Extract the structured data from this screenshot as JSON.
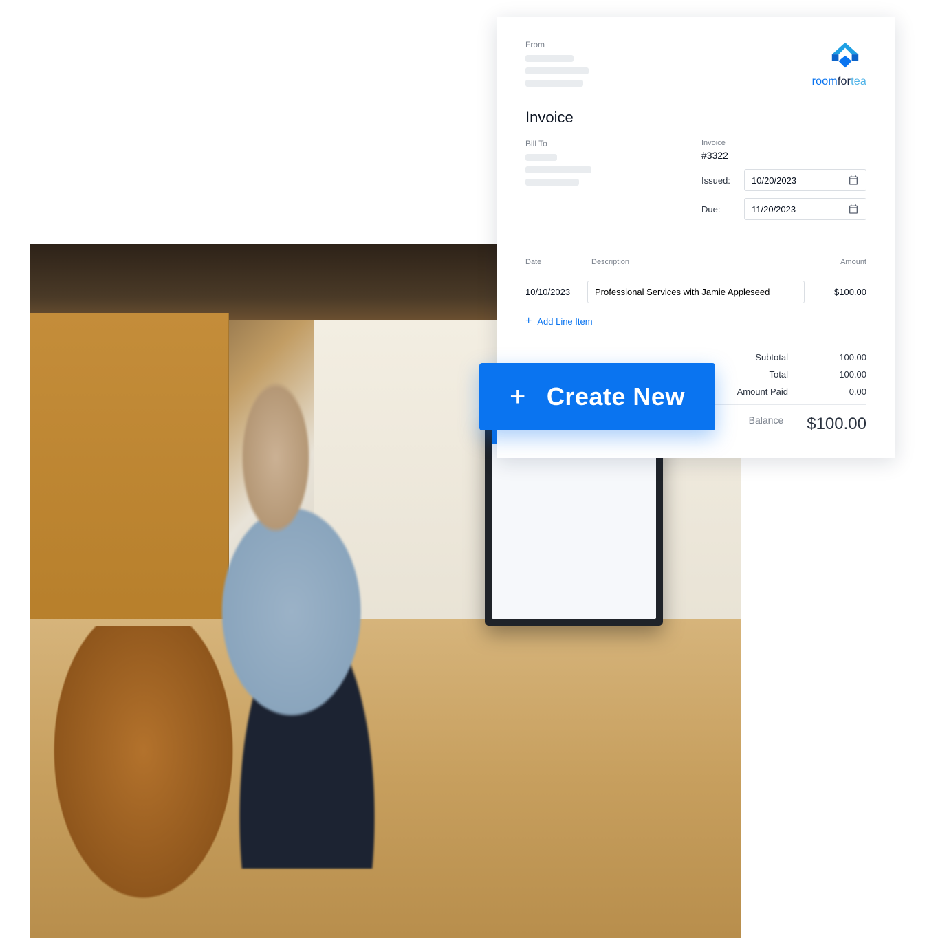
{
  "brand": {
    "word1": "room",
    "word2": "for",
    "word3": "tea"
  },
  "invoice": {
    "from_label": "From",
    "title": "Invoice",
    "billto_label": "Bill To",
    "meta": {
      "label": "Invoice",
      "number": "#3322",
      "issued_label": "Issued:",
      "issued_date": "10/20/2023",
      "due_label": "Due:",
      "due_date": "11/20/2023"
    },
    "columns": {
      "date": "Date",
      "description": "Description",
      "amount": "Amount"
    },
    "lines": [
      {
        "date": "10/10/2023",
        "description": "Professional Services with Jamie Appleseed",
        "amount": "$100.00"
      }
    ],
    "add_line_label": "Add Line Item",
    "totals": {
      "subtotal_label": "Subtotal",
      "subtotal_value": "100.00",
      "total_label": "Total",
      "total_value": "100.00",
      "paid_label": "Amount Paid",
      "paid_value": "0.00",
      "balance_label": "Balance",
      "balance_value": "$100.00"
    }
  },
  "create_button": "Create New"
}
